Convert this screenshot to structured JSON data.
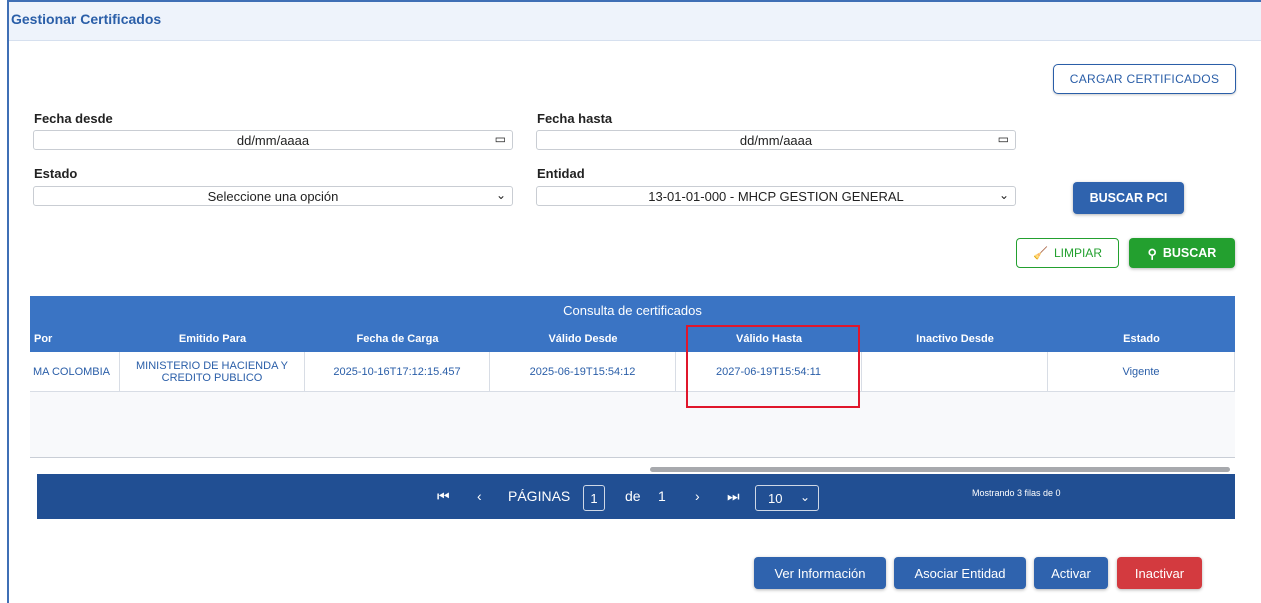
{
  "window": {
    "title": "Gestionar Certificados"
  },
  "top_button": "CARGAR CERTIFICADOS",
  "filters": {
    "fecha_desde": {
      "label": "Fecha desde",
      "value": "dd/mm/aaaa"
    },
    "fecha_hasta": {
      "label": "Fecha hasta",
      "value": "dd/mm/aaaa"
    },
    "estado": {
      "label": "Estado",
      "value": "Seleccione una opción"
    },
    "entidad": {
      "label": "Entidad",
      "value": "13-01-01-000 - MHCP GESTION GENERAL"
    },
    "buscar_pci": "BUSCAR PCI",
    "limpiar": "LIMPIAR",
    "buscar": "BUSCAR"
  },
  "grid": {
    "title": "Consulta de certificados",
    "columns": [
      "Por",
      "Emitido Para",
      "Fecha de Carga",
      "Válido Desde",
      "Válido Hasta",
      "Inactivo Desde",
      "Estado"
    ],
    "rows": [
      [
        "MA COLOMBIA",
        "MINISTERIO DE HACIENDA Y CREDITO PUBLICO",
        "2025-10-16T17:12:15.457",
        "2025-06-19T15:54:12",
        "2027-06-19T15:54:11",
        "",
        "Vigente"
      ]
    ]
  },
  "pager": {
    "label": "PÁGINAS",
    "current": "1",
    "of_label": "de",
    "total": "1",
    "page_size": "10",
    "info": "Mostrando 3 filas de 0"
  },
  "actions": {
    "ver": "Ver Información",
    "asociar": "Asociar Entidad",
    "activar": "Activar",
    "inactivar": "Inactivar"
  }
}
